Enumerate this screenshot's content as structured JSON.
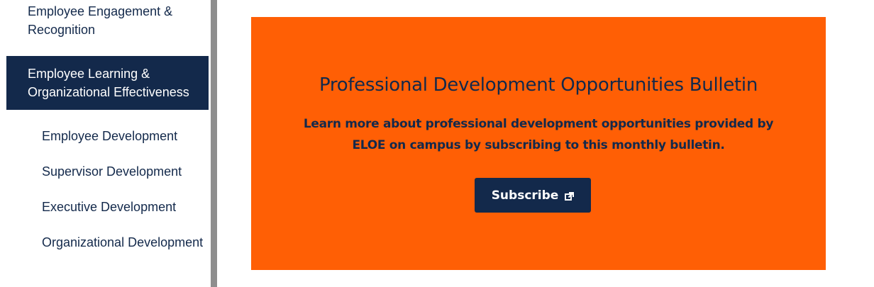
{
  "sidebar": {
    "items": [
      {
        "label": "Employee Engagement & Recognition",
        "active": false
      },
      {
        "label": "Employee Learning & Organizational Effectiveness",
        "active": true
      }
    ],
    "subitems": [
      {
        "label": "Employee Development"
      },
      {
        "label": "Supervisor Development"
      },
      {
        "label": "Executive Development"
      },
      {
        "label": "Organizational Development"
      }
    ]
  },
  "banner": {
    "title": "Professional Development Opportunities Bulletin",
    "text": "Learn more about professional development opportunities provided by ELOE on campus by subscribing to this monthly bulletin.",
    "button_label": "Subscribe",
    "button_icon": "external-link-icon"
  },
  "colors": {
    "navy": "#13294b",
    "orange": "#ff5f05",
    "rule": "#8e8e8e",
    "white": "#ffffff"
  }
}
